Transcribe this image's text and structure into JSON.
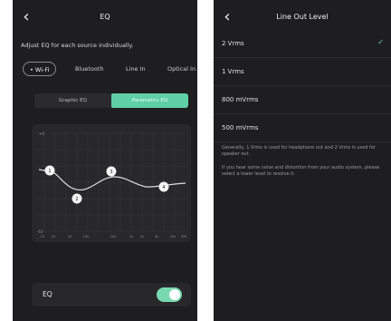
{
  "left": {
    "title": "EQ",
    "subtitle": "Adjust EQ for each source individually.",
    "source_tabs": [
      "Wi-Fi",
      "Bluetooth",
      "Line In",
      "Optical In"
    ],
    "mode_tabs": [
      "Graphic EQ",
      "Parametric EQ"
    ],
    "graph": {
      "y_labels": [
        "+6",
        "-10"
      ],
      "x_labels": [
        "10",
        "20",
        "30",
        "100",
        "400",
        "1k",
        "2k",
        "4k",
        "10k",
        "20k"
      ],
      "points": [
        "1",
        "2",
        "3",
        "4"
      ]
    },
    "eq_toggle": {
      "label": "EQ",
      "state": "on"
    }
  },
  "right": {
    "title": "Line Out Level",
    "options": [
      {
        "label": "2 Vrms",
        "selected": true
      },
      {
        "label": "1 Vrms",
        "selected": false
      },
      {
        "label": "800 mVrms",
        "selected": false
      },
      {
        "label": "500 mVrms",
        "selected": false
      }
    ],
    "note1": "Generally, 1 Vrms is used for headphone out and 2 Vrms is used for speaker out.",
    "note2": "If you hear some noise and distortion from your audio system, please select a lower level to resolve it."
  },
  "icons": {
    "back": "chevron-left-icon",
    "check": "check-icon"
  },
  "colors": {
    "accent": "#5fcfa6",
    "toggle_on": "#78d8ae",
    "background": "#1e1e20",
    "card": "#28282a"
  }
}
